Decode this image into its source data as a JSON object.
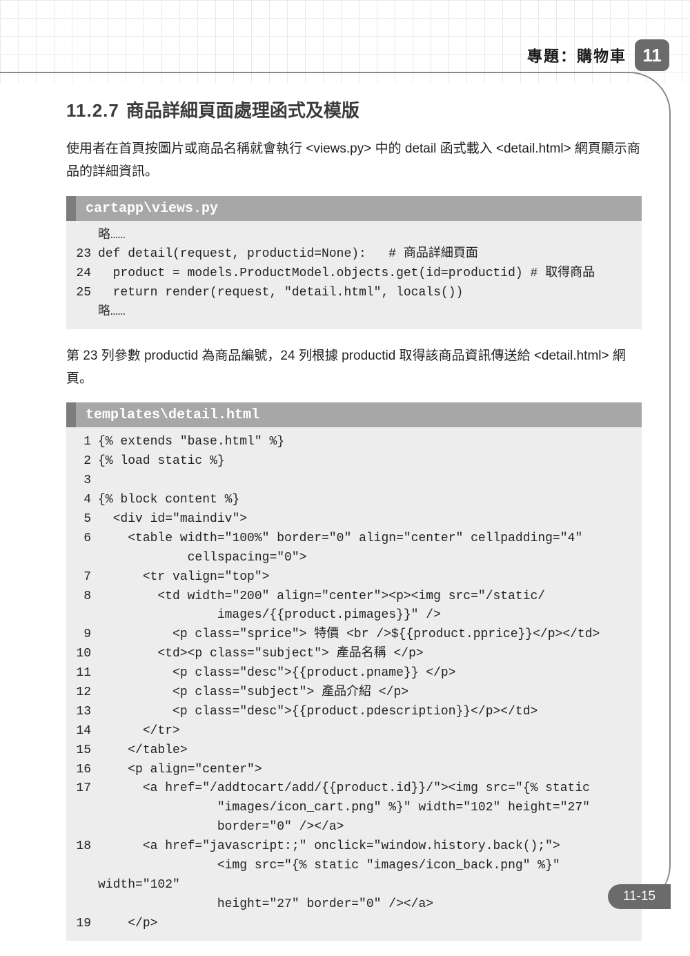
{
  "header": {
    "chapter_label": "專題：購物車",
    "chapter_number": "11"
  },
  "section": {
    "number": "11.2.7",
    "title": "商品詳細頁面處理函式及模版"
  },
  "intro_paragraph": "使用者在首頁按圖片或商品名稱就會執行 <views.py> 中的 detail 函式載入 <detail.html> 網頁顯示商品的詳細資訊。",
  "code1": {
    "filename": "cartapp\\views.py",
    "omit_before": "略……",
    "lines": [
      {
        "n": "23",
        "t": "def detail(request, productid=None):   # 商品詳細頁面"
      },
      {
        "n": "24",
        "t": "  product = models.ProductModel.objects.get(id=productid) # 取得商品"
      },
      {
        "n": "25",
        "t": "  return render(request, \"detail.html\", locals())"
      }
    ],
    "omit_after": "略……"
  },
  "mid_paragraph": "第 23 列參數 productid 為商品編號，24 列根據 productid 取得該商品資訊傳送給 <detail.html> 網頁。",
  "code2": {
    "filename": "templates\\detail.html",
    "lines": [
      {
        "n": "1",
        "t": "{% extends \"base.html\" %}"
      },
      {
        "n": "2",
        "t": "{% load static %}"
      },
      {
        "n": "3",
        "t": ""
      },
      {
        "n": "4",
        "t": "{% block content %}"
      },
      {
        "n": "5",
        "t": "  <div id=\"maindiv\">"
      },
      {
        "n": "6",
        "t": "    <table width=\"100%\" border=\"0\" align=\"center\" cellpadding=\"4\"\n            cellspacing=\"0\">"
      },
      {
        "n": "7",
        "t": "      <tr valign=\"top\">"
      },
      {
        "n": "8",
        "t": "        <td width=\"200\" align=\"center\"><p><img src=\"/static/\n                images/{{product.pimages}}\" />"
      },
      {
        "n": "9",
        "t": "          <p class=\"sprice\"> 特價 <br />${{product.pprice}}</p></td>"
      },
      {
        "n": "10",
        "t": "        <td><p class=\"subject\"> 產品名稱 </p>"
      },
      {
        "n": "11",
        "t": "          <p class=\"desc\">{{product.pname}} </p>"
      },
      {
        "n": "12",
        "t": "          <p class=\"subject\"> 產品介紹 </p>"
      },
      {
        "n": "13",
        "t": "          <p class=\"desc\">{{product.pdescription}}</p></td>"
      },
      {
        "n": "14",
        "t": "      </tr>"
      },
      {
        "n": "15",
        "t": "    </table>"
      },
      {
        "n": "16",
        "t": "    <p align=\"center\">"
      },
      {
        "n": "17",
        "t": "      <a href=\"/addtocart/add/{{product.id}}/\"><img src=\"{% static\n                \"images/icon_cart.png\" %}\" width=\"102\" height=\"27\"\n                border=\"0\" /></a>"
      },
      {
        "n": "18",
        "t": "      <a href=\"javascript:;\" onclick=\"window.history.back();\">\n                <img src=\"{% static \"images/icon_back.png\" %}\" width=\"102\"\n                height=\"27\" border=\"0\" /></a>"
      },
      {
        "n": "19",
        "t": "    </p>"
      }
    ]
  },
  "page_number": "11-15"
}
